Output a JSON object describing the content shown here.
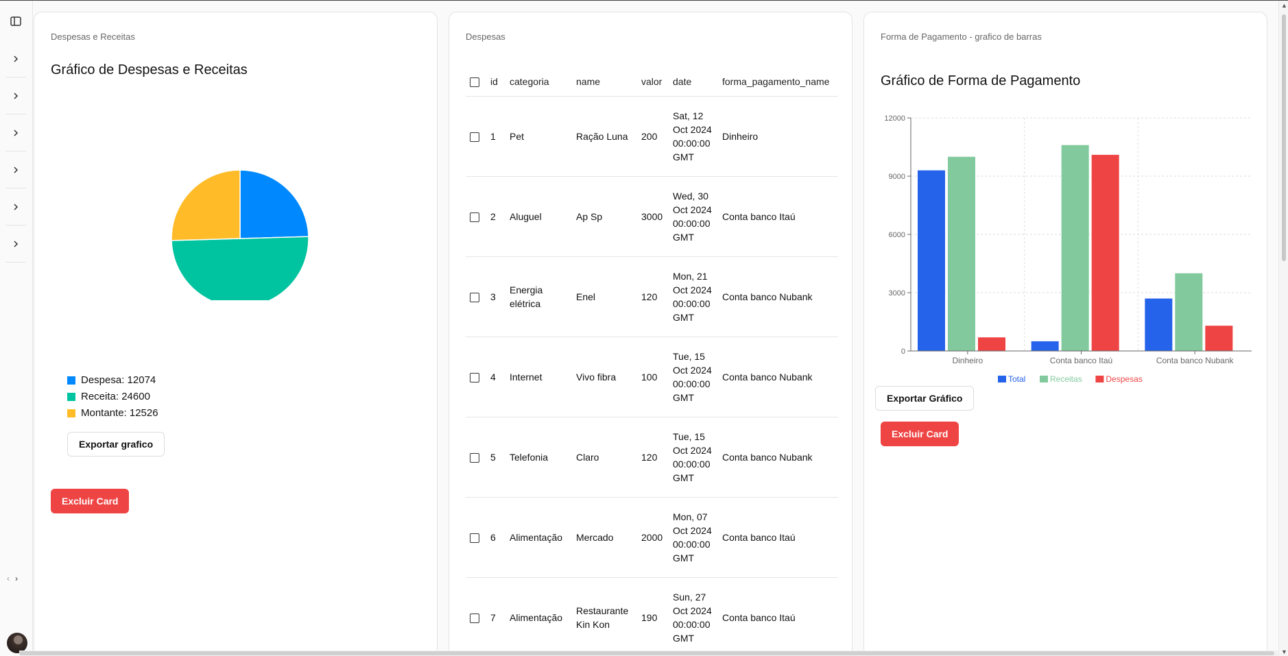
{
  "sidebar": {
    "item_count": 6
  },
  "card1": {
    "label": "Despesas e Receitas",
    "title": "Gráfico de Despesas e Receitas",
    "legend": [
      {
        "text": "Despesa: 12074",
        "color": "#0088fe"
      },
      {
        "text": "Receita: 24600",
        "color": "#00c49f"
      },
      {
        "text": "Montante: 12526",
        "color": "#ffbb28"
      }
    ],
    "export_label": "Exportar grafico",
    "delete_label": "Excluir Card"
  },
  "card2": {
    "label": "Despesas",
    "columns": [
      "id",
      "categoria",
      "name",
      "valor",
      "date",
      "forma_pagamento_name"
    ],
    "rows": [
      [
        "1",
        "Pet",
        "Ração Luna",
        "200",
        "Sat, 12 Oct 2024 00:00:00 GMT",
        "Dinheiro"
      ],
      [
        "2",
        "Aluguel",
        "Ap Sp",
        "3000",
        "Wed, 30 Oct 2024 00:00:00 GMT",
        "Conta banco Itaú"
      ],
      [
        "3",
        "Energia elétrica",
        "Enel",
        "120",
        "Mon, 21 Oct 2024 00:00:00 GMT",
        "Conta banco Nubank"
      ],
      [
        "4",
        "Internet",
        "Vivo fibra",
        "100",
        "Tue, 15 Oct 2024 00:00:00 GMT",
        "Conta banco Nubank"
      ],
      [
        "5",
        "Telefonia",
        "Claro",
        "120",
        "Tue, 15 Oct 2024 00:00:00 GMT",
        "Conta banco Nubank"
      ],
      [
        "6",
        "Alimentação",
        "Mercado",
        "2000",
        "Mon, 07 Oct 2024 00:00:00 GMT",
        "Conta banco Itaú"
      ],
      [
        "7",
        "Alimentação",
        "Restaurante Kin Kon",
        "190",
        "Sun, 27 Oct 2024 00:00:00 GMT",
        "Conta banco Itaú"
      ]
    ]
  },
  "card3": {
    "label": "Forma de Pagamento - grafico de barras",
    "title": "Gráfico de Forma de Pagamento",
    "export_label": "Exportar Gráfico",
    "delete_label": "Excluir Card"
  },
  "chart_data": [
    {
      "type": "pie",
      "slices": [
        {
          "name": "Despesa",
          "value": 12074,
          "color": "#0088fe"
        },
        {
          "name": "Receita",
          "value": 24600,
          "color": "#00c49f"
        },
        {
          "name": "Montante",
          "value": 12526,
          "color": "#ffbb28"
        }
      ]
    },
    {
      "type": "bar",
      "categories": [
        "Dinheiro",
        "Conta banco Itaú",
        "Conta banco Nubank"
      ],
      "series": [
        {
          "name": "Total",
          "values": [
            9300,
            500,
            2700
          ],
          "color": "#2563eb"
        },
        {
          "name": "Receitas",
          "values": [
            10000,
            10600,
            4000
          ],
          "color": "#82ca9d"
        },
        {
          "name": "Despesas",
          "values": [
            700,
            10100,
            1300
          ],
          "color": "#ef4444"
        }
      ],
      "yticks": [
        0,
        3000,
        6000,
        9000,
        12000
      ],
      "ylim": [
        0,
        12000
      ],
      "grid": true,
      "legend_position": "bottom"
    }
  ]
}
